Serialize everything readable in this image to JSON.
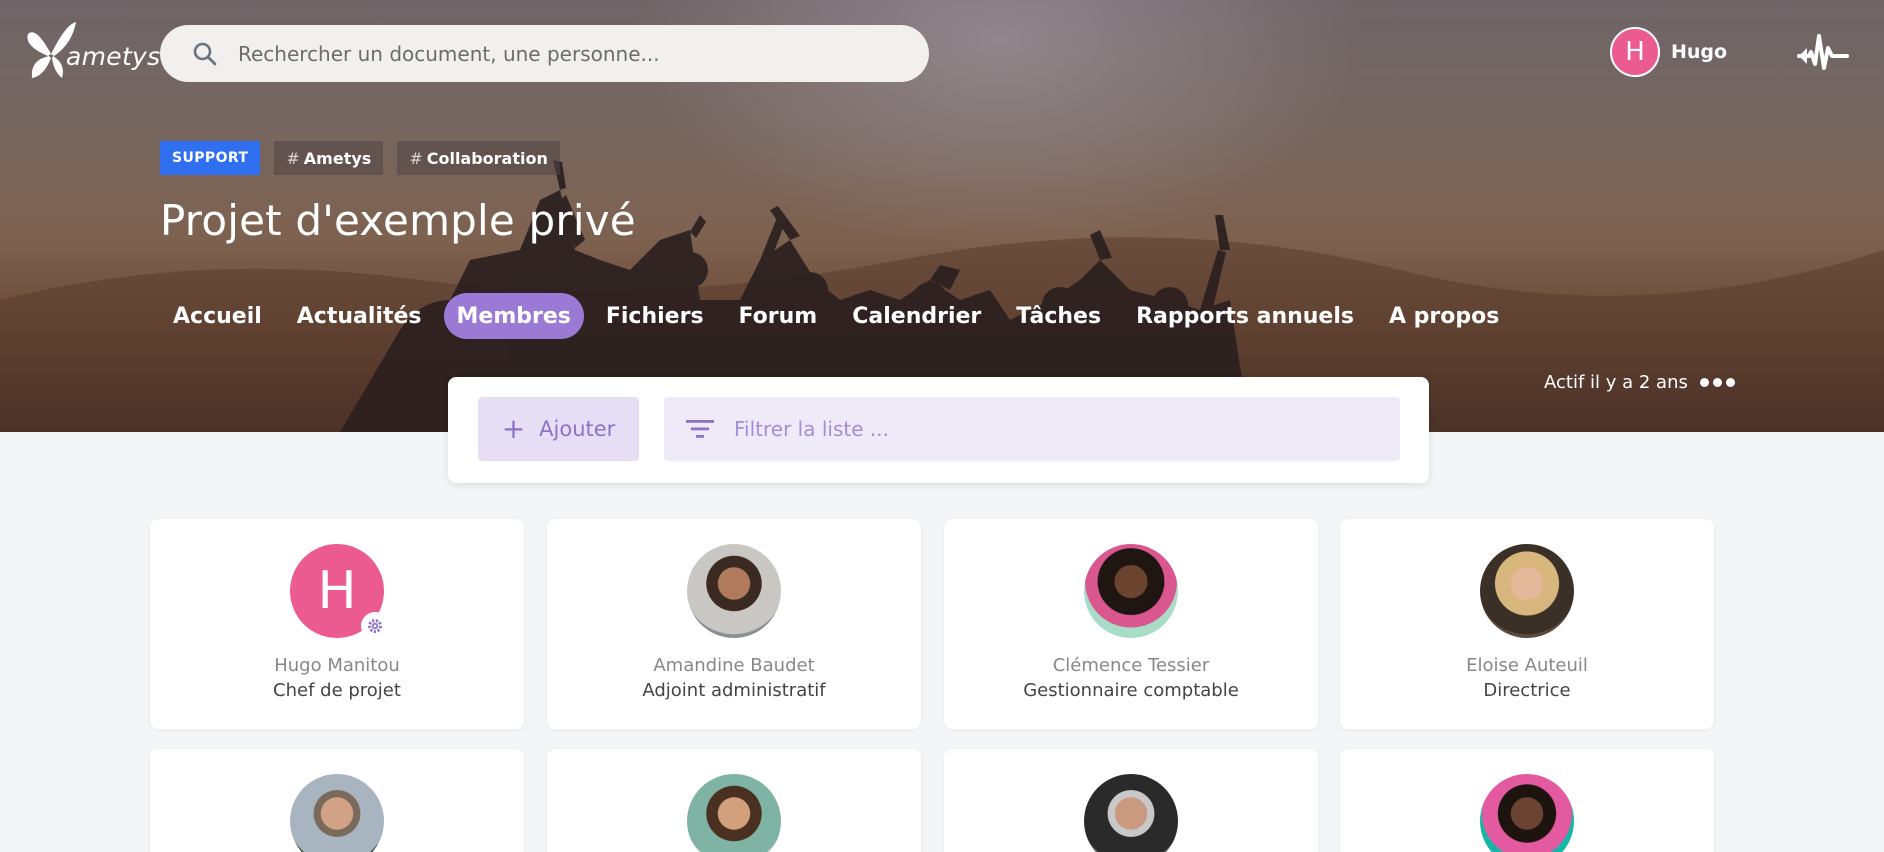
{
  "brand": {
    "logo_text": "ametys"
  },
  "search": {
    "placeholder": "Rechercher un document, une personne..."
  },
  "user": {
    "initial": "H",
    "name": "Hugo"
  },
  "project": {
    "tags": [
      {
        "label": "SUPPORT"
      },
      {
        "label": "Ametys"
      },
      {
        "label": "Collaboration"
      }
    ],
    "title": "Projet d'exemple privé",
    "activity": "Actif il y a 2 ans"
  },
  "nav": {
    "items": [
      {
        "label": "Accueil"
      },
      {
        "label": "Actualités"
      },
      {
        "label": "Membres",
        "active": true
      },
      {
        "label": "Fichiers"
      },
      {
        "label": "Forum"
      },
      {
        "label": "Calendrier"
      },
      {
        "label": "Tâches"
      },
      {
        "label": "Rapports annuels"
      },
      {
        "label": "A propos"
      }
    ]
  },
  "toolbar": {
    "add_label": "Ajouter",
    "filter_placeholder": "Filtrer la liste ..."
  },
  "members": [
    {
      "name": "Hugo Manitou",
      "role": "Chef de projet",
      "initial": "H"
    },
    {
      "name": "Amandine Baudet",
      "role": "Adjoint administratif"
    },
    {
      "name": "Clémence Tessier",
      "role": "Gestionnaire comptable"
    },
    {
      "name": "Eloise Auteuil",
      "role": "Directrice"
    },
    {
      "name": "",
      "role": ""
    },
    {
      "name": "",
      "role": ""
    },
    {
      "name": "",
      "role": ""
    },
    {
      "name": "",
      "role": ""
    }
  ],
  "colors": {
    "accent": "#9b7ad6",
    "support_tag": "#2f6ff0",
    "avatar_pink": "#ec5b8f"
  }
}
